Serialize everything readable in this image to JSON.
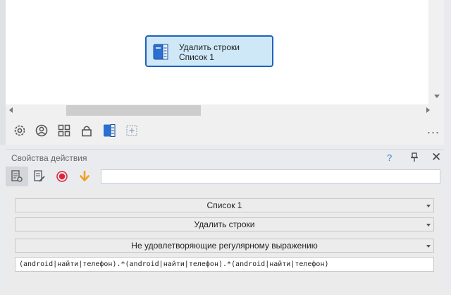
{
  "canvas": {
    "action_block": {
      "title": "Удалить строки",
      "subtitle": "Список 1",
      "icon": "list-book-icon"
    }
  },
  "bottom_toolbar": {
    "icons": [
      "settings-icon",
      "user-circle-icon",
      "grid-icon",
      "lock-icon",
      "list-book-icon",
      "add-block-icon"
    ],
    "more_label": "..."
  },
  "panel": {
    "title": "Свойства действия",
    "help_label": "?",
    "close_label": "✕",
    "tabs": [
      "properties-tab-icon",
      "edit-tab-icon",
      "record-icon",
      "arrow-down-icon"
    ],
    "search": {
      "value": "",
      "placeholder": ""
    }
  },
  "properties": {
    "list_select": "Список 1",
    "action_select": "Удалить строки",
    "mode_select": "Не удовлетворяющие регулярному выражению",
    "regex_value": "(android|найти|телефон).*(android|найти|телефон).*(android|найти|телефон)"
  },
  "colors": {
    "accent": "#1f63b8",
    "block_fill": "#cfe8f8",
    "record": "#e0243a",
    "arrow": "#f0a020"
  }
}
